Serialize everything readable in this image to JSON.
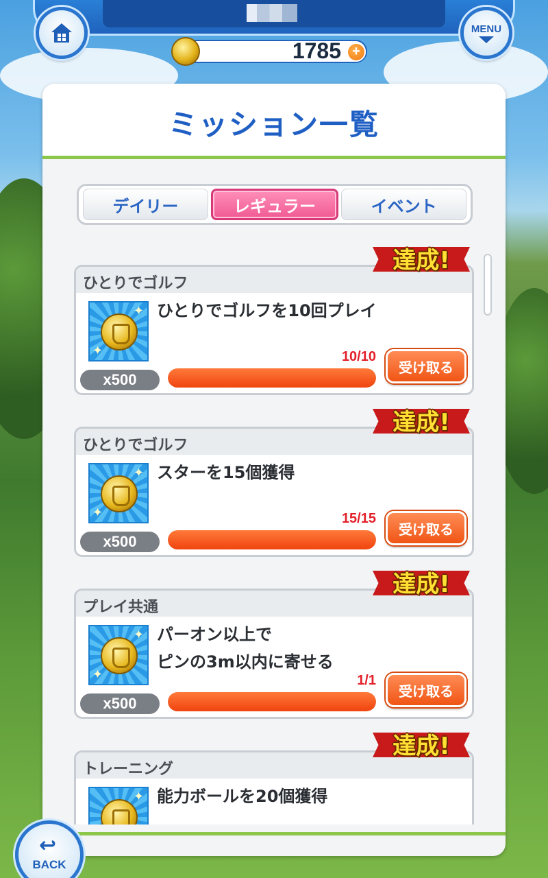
{
  "header": {
    "coins": "1785",
    "plus_label": "+",
    "menu_label": "MENU",
    "home_icon": "home-icon"
  },
  "panel": {
    "title": "ミッション一覧"
  },
  "tabs": [
    {
      "label": "デイリー",
      "active": false
    },
    {
      "label": "レギュラー",
      "active": true
    },
    {
      "label": "イベント",
      "active": false
    }
  ],
  "missions": [
    {
      "category": "ひとりでゴルフ",
      "text": "ひとりでゴルフを10回プレイ",
      "reward": "x500",
      "progress": "10/10",
      "progress_fraction": 1.0,
      "claim_label": "受け取る",
      "badge": "達成!"
    },
    {
      "category": "ひとりでゴルフ",
      "text": "スターを15個獲得",
      "reward": "x500",
      "progress": "15/15",
      "progress_fraction": 1.0,
      "claim_label": "受け取る",
      "badge": "達成!"
    },
    {
      "category": "プレイ共通",
      "text_line1": "パーオン以上で",
      "text_line2": "ピンの3m以内に寄せる",
      "reward": "x500",
      "progress": "1/1",
      "progress_fraction": 1.0,
      "claim_label": "受け取る",
      "badge": "達成!"
    },
    {
      "category": "トレーニング",
      "text": "能力ボールを20個獲得",
      "badge": "達成!"
    }
  ],
  "footer": {
    "back_label": "BACK"
  },
  "colors": {
    "accent_blue": "#1f5fc4",
    "active_tab_pink": "#f05a94",
    "progress_orange": "#f0440f",
    "badge_red": "#c81a1a"
  }
}
